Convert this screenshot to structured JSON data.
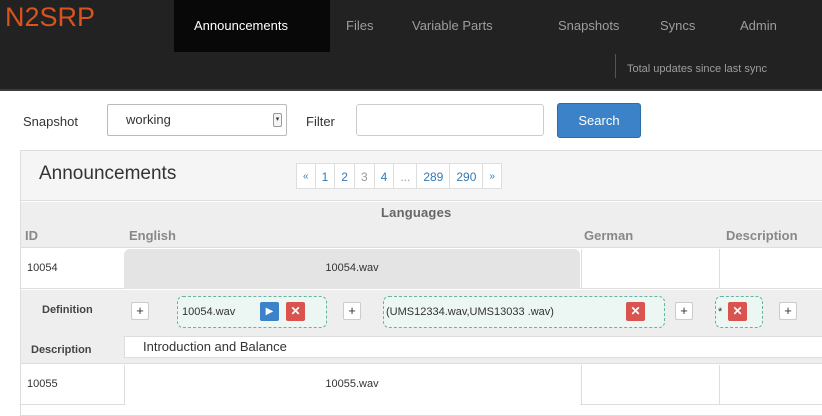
{
  "app": {
    "brand": "N2SRP"
  },
  "nav": {
    "items": [
      "Announcements",
      "Files",
      "Variable Parts",
      "Snapshots",
      "Syncs",
      "Admin"
    ],
    "sub_text": "Total updates since last sync"
  },
  "search": {
    "snapshot_label": "Snapshot",
    "snapshot_value": "working",
    "filter_label": "Filter",
    "filter_value": "",
    "button": "Search"
  },
  "panel": {
    "title": "Announcements",
    "pagination": [
      "«",
      "1",
      "2",
      "3",
      "4",
      "...",
      "289",
      "290",
      "»"
    ],
    "current_page": "3"
  },
  "table": {
    "languages_label": "Languages",
    "columns": [
      "ID",
      "English",
      "German",
      "Description"
    ],
    "rows": [
      {
        "id": "10054",
        "english": "10054.wav"
      },
      {
        "id": "10055",
        "english": "10055.wav"
      }
    ],
    "definition": {
      "label": "Definition",
      "chips": [
        "10054.wav",
        "(UMS12334.wav,UMS13033 .wav)",
        "*"
      ],
      "add_symbol": "+",
      "play_symbol": "▶",
      "remove_symbol": "✕"
    },
    "description": {
      "label": "Description",
      "value": "Introduction and Balance"
    }
  },
  "colors": {
    "navbar_bg": "#222222",
    "brand": "#d9531e",
    "primary": "#3b82c8",
    "danger": "#d9534f",
    "chip_border": "#66b3a1"
  }
}
